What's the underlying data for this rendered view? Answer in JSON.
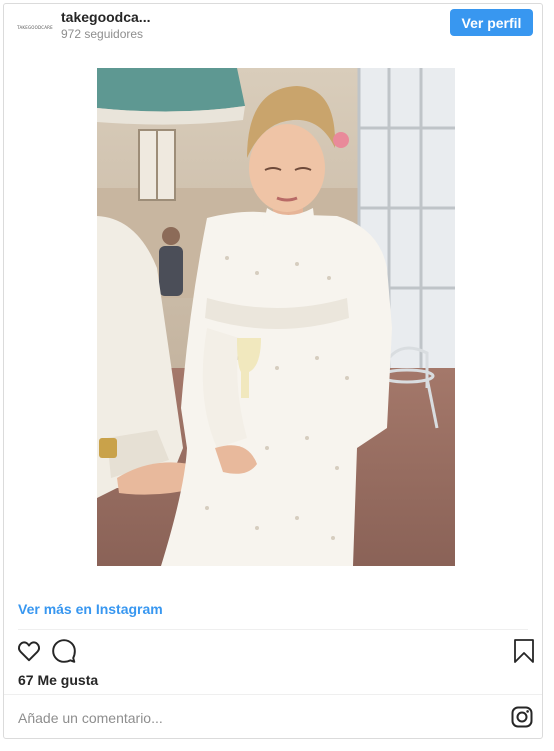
{
  "header": {
    "avatar_text": "TAKEGOODCARE",
    "username": "takegoodca...",
    "followers": "972 seguidores",
    "follow_label": "Ver perfil"
  },
  "post": {
    "image_description": "",
    "see_more": "Ver más en Instagram",
    "likes": "67 Me gusta"
  },
  "icons": {
    "like": "heart-icon",
    "comment": "comment-icon",
    "save": "bookmark-icon",
    "brand": "instagram-icon"
  },
  "comment": {
    "placeholder": "Añade un comentario..."
  },
  "colors": {
    "accent": "#3897f0",
    "text": "#262626",
    "muted": "#8e8e8e",
    "border": "#dbdbdb"
  }
}
